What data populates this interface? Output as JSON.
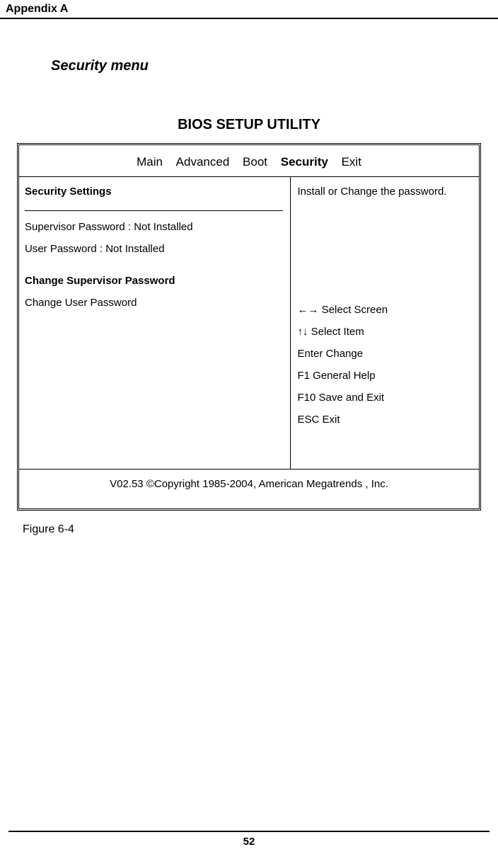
{
  "header": {
    "appendix_label": "Appendix A"
  },
  "section": {
    "title": "Security menu"
  },
  "bios": {
    "utility_title": "BIOS SETUP UTILITY",
    "tabs": {
      "main": "Main",
      "advanced": "Advanced",
      "boot": "Boot",
      "security": "Security",
      "exit": "Exit"
    },
    "left": {
      "heading": "Security Settings",
      "supervisor_line": "Supervisor Password : Not Installed",
      "user_line": " User Password       : Not Installed",
      "change_supervisor": "Change Supervisor Password",
      "change_user": "Change User Password"
    },
    "right": {
      "description": "Install or Change the password.",
      "help": {
        "select_screen": "←→ Select Screen",
        "select_item": "↑↓ Select Item",
        "enter_change": "Enter Change",
        "f1": "F1  General Help",
        "f10": "F10 Save and Exit",
        "esc": "ESC Exit"
      }
    },
    "footer": "V02.53 ©Copyright 1985-2004, American Megatrends , Inc."
  },
  "figure_label": "Figure 6-4",
  "page_number": "52"
}
